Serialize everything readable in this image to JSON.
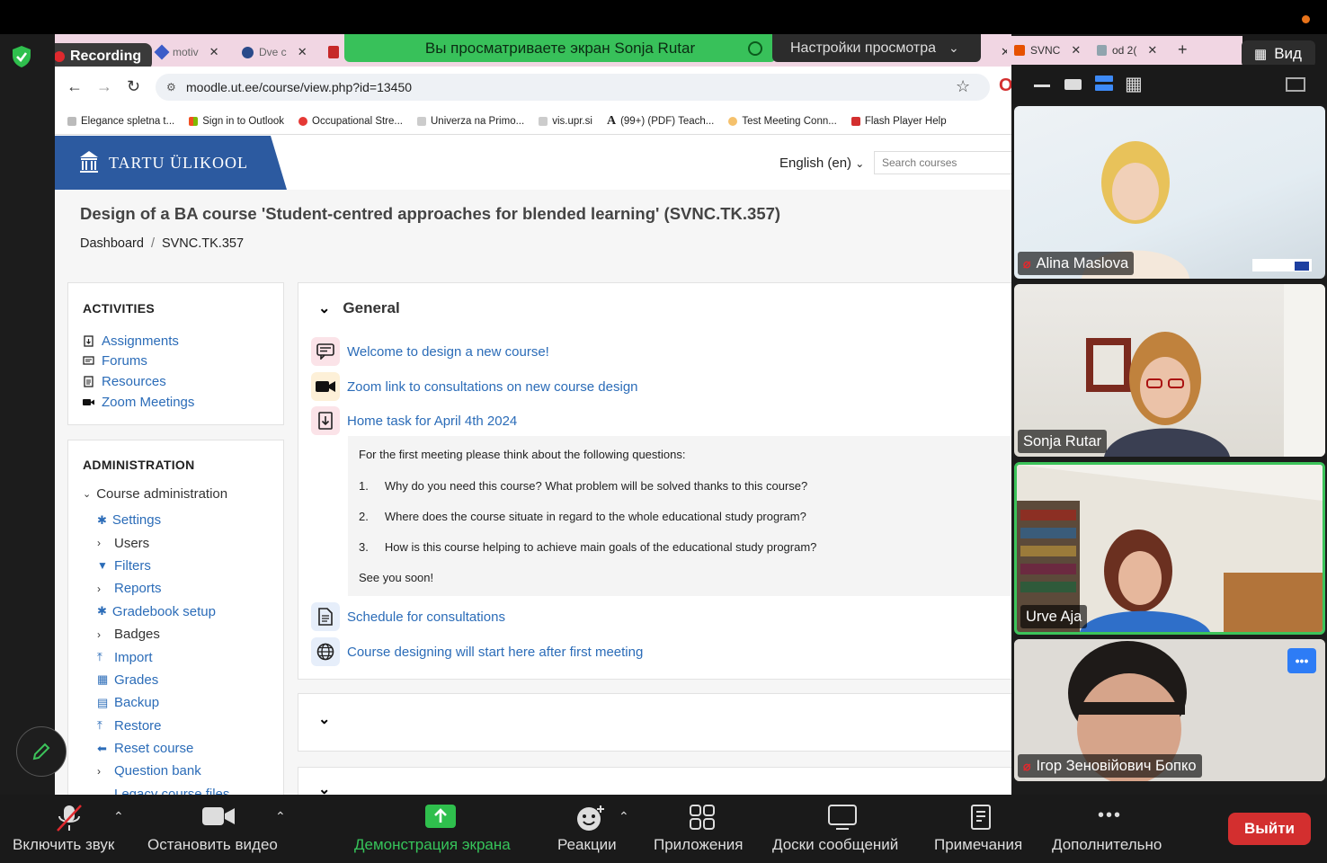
{
  "zoom": {
    "recording_label": "Recording",
    "share_banner": "Вы просматриваете экран Sonja Rutar",
    "view_settings": "Настройки просмотра",
    "view_button": "Вид",
    "toolbar": {
      "unmute": "Включить звук",
      "stop_video": "Остановить видео",
      "share_screen": "Демонстрация экрана",
      "reactions": "Реакции",
      "apps": "Приложения",
      "whiteboards": "Доски сообщений",
      "notes": "Примечания",
      "more": "Дополнительно",
      "leave": "Выйти"
    },
    "participants": [
      {
        "name": "Alina Maslova",
        "muted": true
      },
      {
        "name": "Sonja Rutar",
        "muted": false
      },
      {
        "name": "Urve Aja",
        "muted": false,
        "active_speaker": true
      },
      {
        "name": "Ігор Зеновійович Бопко",
        "muted": true
      }
    ]
  },
  "browser": {
    "tabs": [
      {
        "label": "motiv"
      },
      {
        "label": "Dve c"
      },
      {
        "label": "SVNC"
      },
      {
        "label": "od 2("
      }
    ],
    "url": "moodle.ut.ee/course/view.php?id=13450",
    "bookmarks": [
      "Elegance spletna t...",
      "Sign in to Outlook",
      "Occupational Stre...",
      "Univerza na Primo...",
      "vis.upr.si",
      "(99+) (PDF) Teach...",
      "Test Meeting Conn...",
      "Flash Player Help"
    ]
  },
  "moodle": {
    "logo_text": "TARTU ÜLIKOOL",
    "language": "English (en)",
    "search_placeholder": "Search courses",
    "course_title": "Design of a BA course 'Student-centred approaches for blended learning' (SVNC.TK.357)",
    "breadcrumb": [
      "Dashboard",
      "SVNC.TK.357"
    ],
    "activities": {
      "title": "ACTIVITIES",
      "items": [
        "Assignments",
        "Forums",
        "Resources",
        "Zoom Meetings"
      ]
    },
    "administration": {
      "title": "ADMINISTRATION",
      "group": "Course administration",
      "items": [
        "Settings",
        "Users",
        "Filters",
        "Reports",
        "Gradebook setup",
        "Badges",
        "Import",
        "Grades",
        "Backup",
        "Restore",
        "Reset course",
        "Question bank",
        "Legacy course files"
      ]
    },
    "general": {
      "title": "General",
      "modules": [
        "Welcome to design a new course!",
        "Zoom link to consultations on new course design",
        "Home task for April 4th 2024",
        "Schedule for consultations",
        "Course designing will start here after first meeting"
      ],
      "task_intro": "For the first meeting please think about the following questions:",
      "questions": [
        {
          "num": "1.",
          "text": "Why do you need this course? What problem will be solved thanks to this course?"
        },
        {
          "num": "2.",
          "text": "Where does the course situate in regard to the whole educational study program?"
        },
        {
          "num": "3.",
          "text": "How is this course helping to achieve main goals of the educational study program?"
        }
      ],
      "task_outro": "See you soon!"
    }
  }
}
